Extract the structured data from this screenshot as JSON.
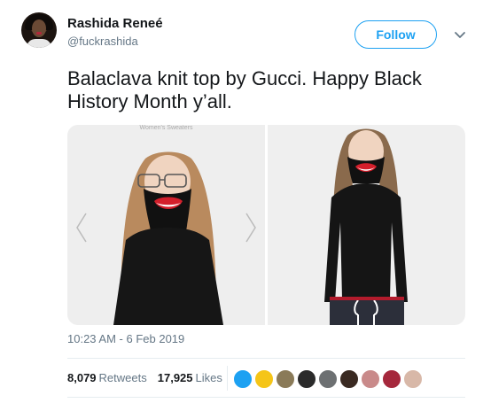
{
  "user": {
    "display_name": "Rashida Reneé",
    "handle": "@fuckrashida"
  },
  "follow_label": "Follow",
  "tweet": {
    "text_line1": "Balaclava knit top by Gucci. Happy Black",
    "text_line2": "History Month y’all.",
    "timestamp": "10:23 AM - 6 Feb 2019"
  },
  "media": {
    "left_caption": "Women's Sweaters"
  },
  "stats": {
    "retweets": "8,079",
    "retweets_label": "Retweets",
    "likes": "17,925",
    "likes_label": "Likes"
  },
  "colors": {
    "accent": "#1da1f2",
    "secondary_text": "#657786",
    "lips": "#d41f2b"
  }
}
